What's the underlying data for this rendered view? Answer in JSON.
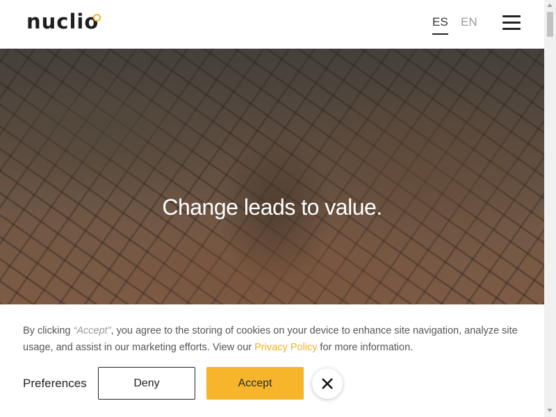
{
  "header": {
    "logo_text": "nuclio",
    "languages": [
      {
        "code": "ES",
        "active": true
      },
      {
        "code": "EN",
        "active": false
      }
    ],
    "menu_icon": "hamburger-menu-icon"
  },
  "hero": {
    "title": "Change leads to value."
  },
  "cookie_banner": {
    "text_before": "By clicking ",
    "text_accept_quote": "“Accept”",
    "text_middle": ", you agree to the storing of cookies on your device to enhance site navigation, analyze site usage, and assist in our marketing efforts. View our ",
    "privacy_link": "Privacy Policy",
    "text_after": " for more information.",
    "preferences_label": "Preferences",
    "deny_label": "Deny",
    "accept_label": "Accept",
    "close_icon": "close-icon"
  },
  "colors": {
    "accent": "#f7b52b",
    "logo_dot": "#f4b42a",
    "text_dark": "#222222"
  }
}
